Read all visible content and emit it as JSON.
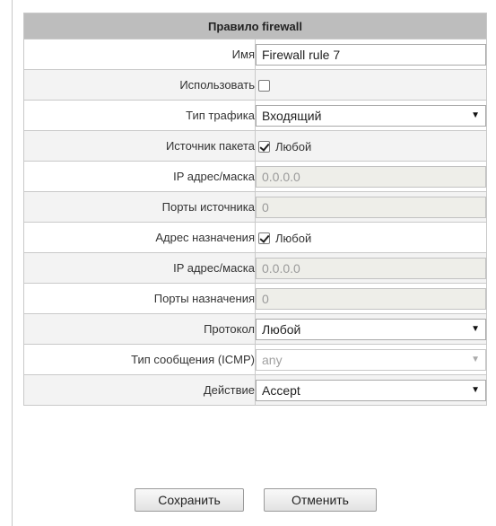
{
  "header": {
    "title": "Правило firewall"
  },
  "fields": {
    "name": {
      "label": "Имя",
      "value": "Firewall rule 7"
    },
    "use": {
      "label": "Использовать",
      "checked": false
    },
    "traffic_type": {
      "label": "Тип трафика",
      "value": "Входящий"
    },
    "source": {
      "label": "Источник пакета",
      "checkbox_label": "Любой",
      "checked": true
    },
    "src_ip": {
      "label": "IP адрес/маска",
      "value": "0.0.0.0"
    },
    "src_ports": {
      "label": "Порты источника",
      "value": "0"
    },
    "dest": {
      "label": "Адрес назначения",
      "checkbox_label": "Любой",
      "checked": true
    },
    "dst_ip": {
      "label": "IP адрес/маска",
      "value": "0.0.0.0"
    },
    "dst_ports": {
      "label": "Порты назначения",
      "value": "0"
    },
    "protocol": {
      "label": "Протокол",
      "value": "Любой"
    },
    "icmp_type": {
      "label": "Тип сообщения (ICMP)",
      "value": "any"
    },
    "action": {
      "label": "Действие",
      "value": "Accept"
    }
  },
  "buttons": {
    "save": "Сохранить",
    "cancel": "Отменить"
  },
  "icons": {
    "dropdown": "▼"
  },
  "colors": {
    "header_bg": "#bdbdbd",
    "row_alt": "#f3f3f3",
    "disabled_input": "#eeeee9"
  }
}
